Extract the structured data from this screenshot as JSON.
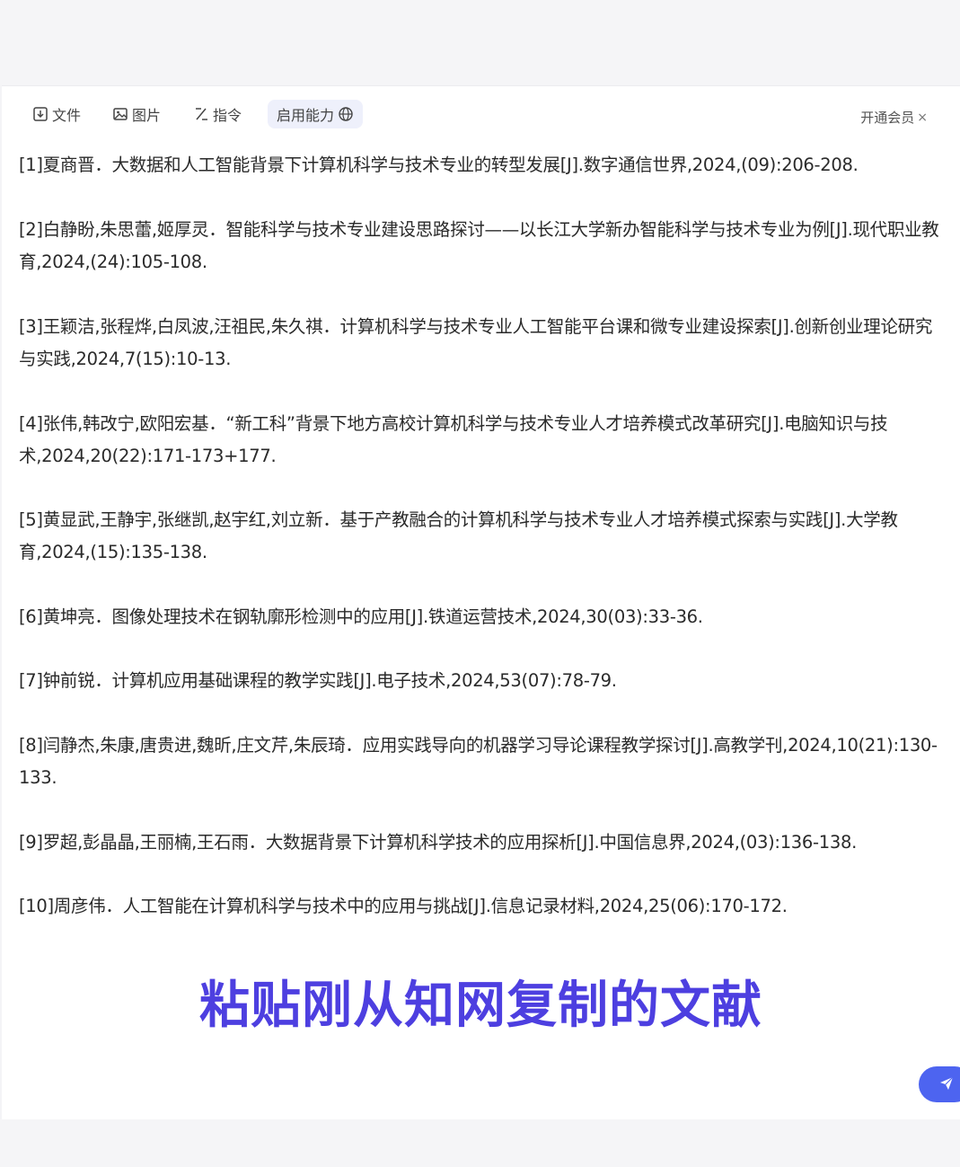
{
  "toolbar": {
    "file_label": "文件",
    "image_label": "图片",
    "command_label": "指令",
    "ability_label": "启用能力",
    "vip_label": "开通会员",
    "vip_close": "×"
  },
  "references": [
    "[1]夏商晋．大数据和人工智能背景下计算机科学与技术专业的转型发展[J].数字通信世界,2024,(09):206-208.",
    "[2]白静盼,朱思蕾,姬厚灵．智能科学与技术专业建设思路探讨——以长江大学新办智能科学与技术专业为例[J].现代职业教育,2024,(24):105-108.",
    "[3]王颖洁,张程烨,白凤波,汪祖民,朱久祺．计算机科学与技术专业人工智能平台课和微专业建设探索[J].创新创业理论研究与实践,2024,7(15):10-13.",
    "[4]张伟,韩改宁,欧阳宏基．“新工科”背景下地方高校计算机科学与技术专业人才培养模式改革研究[J].电脑知识与技术,2024,20(22):171-173+177.",
    "[5]黄显武,王静宇,张继凯,赵宇红,刘立新．基于产教融合的计算机科学与技术专业人才培养模式探索与实践[J].大学教育,2024,(15):135-138.",
    "[6]黄坤亮．图像处理技术在钢轨廓形检测中的应用[J].铁道运营技术,2024,30(03):33-36.",
    "[7]钟前锐．计算机应用基础课程的教学实践[J].电子技术,2024,53(07):78-79.",
    "[8]闫静杰,朱康,唐贵进,魏昕,庄文芹,朱辰琦．应用实践导向的机器学习导论课程教学探讨[J].高教学刊,2024,10(21):130-133.",
    "[9]罗超,彭晶晶,王丽楠,王石雨．大数据背景下计算机科学技术的应用探析[J].中国信息界,2024,(03):136-138.",
    "[10]周彦伟．人工智能在计算机科学与技术中的应用与挑战[J].信息记录材料,2024,25(06):170-172."
  ],
  "caption": "粘贴刚从知网复制的文献",
  "colors": {
    "caption": "#4d3fe0",
    "send_button": "#4d64f0"
  },
  "icons": [
    "file-icon",
    "image-icon",
    "command-icon",
    "globe-icon",
    "send-icon"
  ]
}
